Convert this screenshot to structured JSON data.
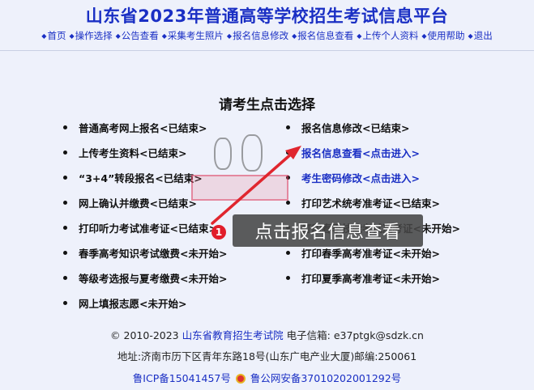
{
  "header": {
    "title": "山东省2023年普通高等学校招生考试信息平台"
  },
  "nav": {
    "items": [
      "首页",
      "操作选择",
      "公告查看",
      "采集考生照片",
      "报名信息修改",
      "报名信息查看",
      "上传个人资料",
      "使用帮助",
      "退出"
    ]
  },
  "main": {
    "heading": "请考生点击选择",
    "left_options": [
      "普通高考网上报名<已结束>",
      "上传考生资料<已结束>",
      "“3+4”转段报名<已结束>",
      "网上确认并缴费<已结束>",
      "打印听力考试准考证<已结束>",
      "春季高考知识考试缴费<未开始>",
      "等级考选报与夏考缴费<未开始>",
      "网上填报志愿<未开始>"
    ],
    "right_options": [
      "报名信息修改<已结束>",
      "报名信息查看<点击进入>",
      "考生密码修改<点击进入>",
      "打印艺术统考准考证<已结束>",
      "打印春季技能考试准考证<未开始>",
      "打印春季高考准考证<未开始>",
      "打印夏季高考准考证<未开始>"
    ]
  },
  "annotation": {
    "badge": "1",
    "callout": "点击报名信息查看",
    "arrow_color": "#e0262e"
  },
  "footer": {
    "copyright_prefix": "© 2010-2023",
    "institute": "山东省教育招生考试院",
    "email_label": "电子信箱:",
    "email": "e37ptgk@sdzk.cn",
    "address": "地址:济南市历下区青年东路18号(山东广电产业大厦)邮编:250061",
    "icp": "鲁ICP备15041457号",
    "police": "鲁公网安备37010202001292号"
  },
  "colors": {
    "link": "#1a2fc4",
    "background": "#eef1fb"
  }
}
